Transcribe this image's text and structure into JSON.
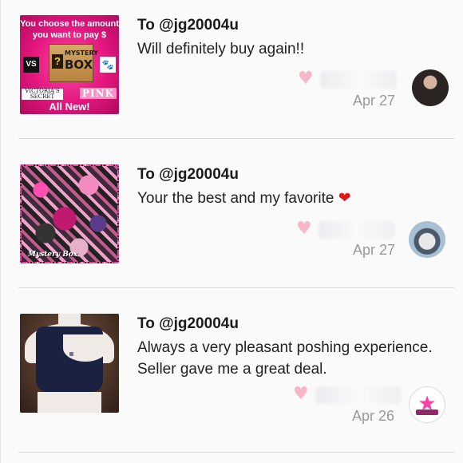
{
  "notes": [
    {
      "recipient": "To @jg20004u",
      "message": "Will definitely buy again!!",
      "date": "Apr 27",
      "thumb": {
        "line1": "You choose the amount",
        "line2": "you want to pay $",
        "box_q": "?",
        "box_top": "MYSTERY",
        "box_bottom": "BOX",
        "vs": "VS",
        "dog": "🐾",
        "vs_wordmark": "VICTORIA'S SECRET",
        "pink": "PINK",
        "all_new": "All New!"
      }
    },
    {
      "recipient": "To @jg20004u",
      "message": "Your the best and my favorite",
      "emoji": "❤",
      "date": "Apr 27",
      "thumb": {
        "label": "Mystery Box"
      }
    },
    {
      "recipient": "To @jg20004u",
      "message": "Always a very pleasant poshing experience. Seller gave me a great deal.",
      "date": "Apr 26",
      "thumb": {}
    }
  ],
  "icons": {
    "like": "heart-icon",
    "like_color": "#f7b7c8"
  }
}
